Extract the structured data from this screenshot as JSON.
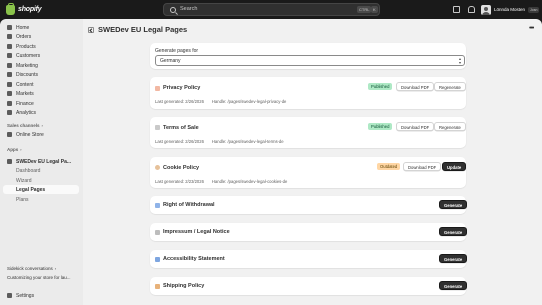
{
  "topbar": {
    "logo_text": "shopify",
    "search_placeholder": "Search",
    "kbd_1": "CTRL",
    "kbd_2": "K",
    "user_name": "Lönnda Mosten",
    "user_badge": "Josn"
  },
  "sidebar": {
    "items": [
      {
        "label": "Home",
        "icon": "home-icon"
      },
      {
        "label": "Orders",
        "icon": "orders-icon"
      },
      {
        "label": "Products",
        "icon": "products-icon"
      },
      {
        "label": "Customers",
        "icon": "customers-icon"
      },
      {
        "label": "Marketing",
        "icon": "marketing-icon"
      },
      {
        "label": "Discounts",
        "icon": "discounts-icon"
      },
      {
        "label": "Content",
        "icon": "content-icon"
      },
      {
        "label": "Markets",
        "icon": "markets-icon"
      },
      {
        "label": "Finance",
        "icon": "finance-icon"
      },
      {
        "label": "Analytics",
        "icon": "analytics-icon"
      }
    ],
    "sales_channels_label": "Sales channels",
    "online_store": "Online Store",
    "apps_label": "Apps",
    "app_name": "SWEDev EU Legal Pa...",
    "app_sub": [
      "Dashboard",
      "Wizard",
      "Legal Pages",
      "Plans"
    ],
    "sidekick": "Sidekick conversations",
    "customizing": "Customizing your store for lau...",
    "settings": "Settings"
  },
  "main": {
    "page_title": "SWEDev EU Legal Pages",
    "generate_label": "Generate pages for",
    "country": "Germany",
    "policies": [
      {
        "title": "Privacy Policy",
        "status": "Published",
        "last_generated": "Last generated: 2/26/2026",
        "handle": "Handle: /pages/swedev-legal-privacy-de",
        "btn1": "Download PDF",
        "btn2": "Regenerate"
      },
      {
        "title": "Terms of Sale",
        "status": "Published",
        "last_generated": "Last generated: 2/26/2026",
        "handle": "Handle: /pages/swedev-legal-terms-de",
        "btn1": "Download PDF",
        "btn2": "Regenerate"
      },
      {
        "title": "Cookie Policy",
        "status": "Outdated",
        "last_generated": "Last generated: 2/23/2026",
        "handle": "Handle: /pages/swedev-legal-cookies-de",
        "btn1": "Download PDF",
        "btn2": "Update"
      },
      {
        "title": "Right of Withdrawal",
        "btn": "Generate"
      },
      {
        "title": "Impressum / Legal Notice",
        "btn": "Generate"
      },
      {
        "title": "Accessibility Statement",
        "btn": "Generate"
      },
      {
        "title": "Shipping Policy",
        "btn": "Generate"
      }
    ]
  },
  "colors": {
    "published_bg": "#aee9c5",
    "outdated_bg": "#ffd6a4",
    "primary_button": "#303030",
    "topbar": "#1a1a1a"
  }
}
